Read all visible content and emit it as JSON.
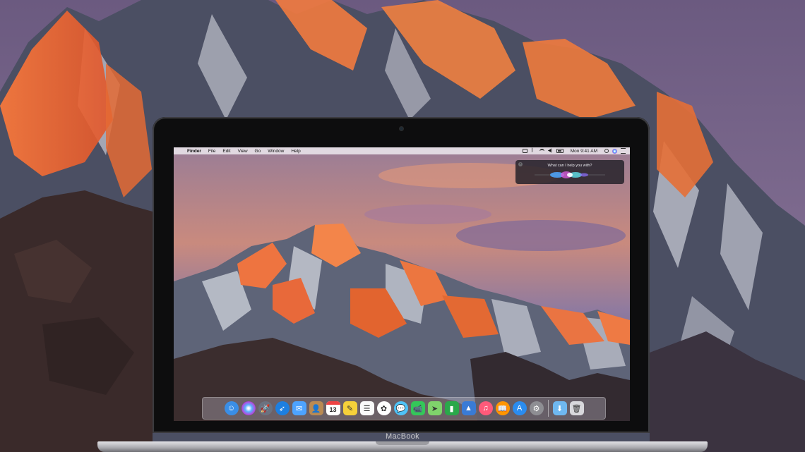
{
  "device": {
    "brand_label": "MacBook"
  },
  "menubar": {
    "apple_glyph": "",
    "items": [
      "Finder",
      "File",
      "Edit",
      "View",
      "Go",
      "Window",
      "Help"
    ],
    "clock": "Mon 9:41 AM",
    "status_icons": [
      "airplay-icon",
      "bluetooth-icon",
      "wifi-icon",
      "volume-icon",
      "battery-icon",
      "spotlight-search-icon",
      "siri-icon",
      "notification-center-icon"
    ]
  },
  "siri": {
    "prompt": "What can I help you with?",
    "close_glyph": "×"
  },
  "dock": {
    "apps": [
      {
        "name": "finder",
        "glyph": "☺",
        "color": "#3a8ee6"
      },
      {
        "name": "siri",
        "glyph": "",
        "color": "#2b1b4a"
      },
      {
        "name": "launchpad",
        "glyph": "🚀",
        "color": "#6b7280"
      },
      {
        "name": "safari",
        "glyph": "➶",
        "color": "#1d7fe0"
      },
      {
        "name": "mail",
        "glyph": "✉",
        "color": "#4da3ff"
      },
      {
        "name": "contacts",
        "glyph": "👤",
        "color": "#b98a52"
      },
      {
        "name": "calendar",
        "glyph": "13",
        "color": "#ffffff"
      },
      {
        "name": "notes",
        "glyph": "✎",
        "color": "#f6d13a"
      },
      {
        "name": "reminders",
        "glyph": "☰",
        "color": "#fafafa"
      },
      {
        "name": "photos",
        "glyph": "✿",
        "color": "#ffffff"
      },
      {
        "name": "messages",
        "glyph": "💬",
        "color": "#4fc3f7"
      },
      {
        "name": "facetime",
        "glyph": "📹",
        "color": "#34c759"
      },
      {
        "name": "maps",
        "glyph": "➤",
        "color": "#7fd36b"
      },
      {
        "name": "numbers",
        "glyph": "▮",
        "color": "#2aa84a"
      },
      {
        "name": "keynote",
        "glyph": "▲",
        "color": "#3a7bd5"
      },
      {
        "name": "itunes",
        "glyph": "♫",
        "color": "#ff5a7a"
      },
      {
        "name": "ibooks",
        "glyph": "📖",
        "color": "#ff9500"
      },
      {
        "name": "app-store",
        "glyph": "A",
        "color": "#2a8cf0"
      },
      {
        "name": "system-preferences",
        "glyph": "⚙",
        "color": "#8e8e93"
      }
    ],
    "folders": [
      {
        "name": "downloads-folder",
        "glyph": "⬇",
        "color": "#6fb8f0"
      },
      {
        "name": "trash",
        "glyph": "🗑",
        "color": "#d8d8dc"
      }
    ]
  }
}
